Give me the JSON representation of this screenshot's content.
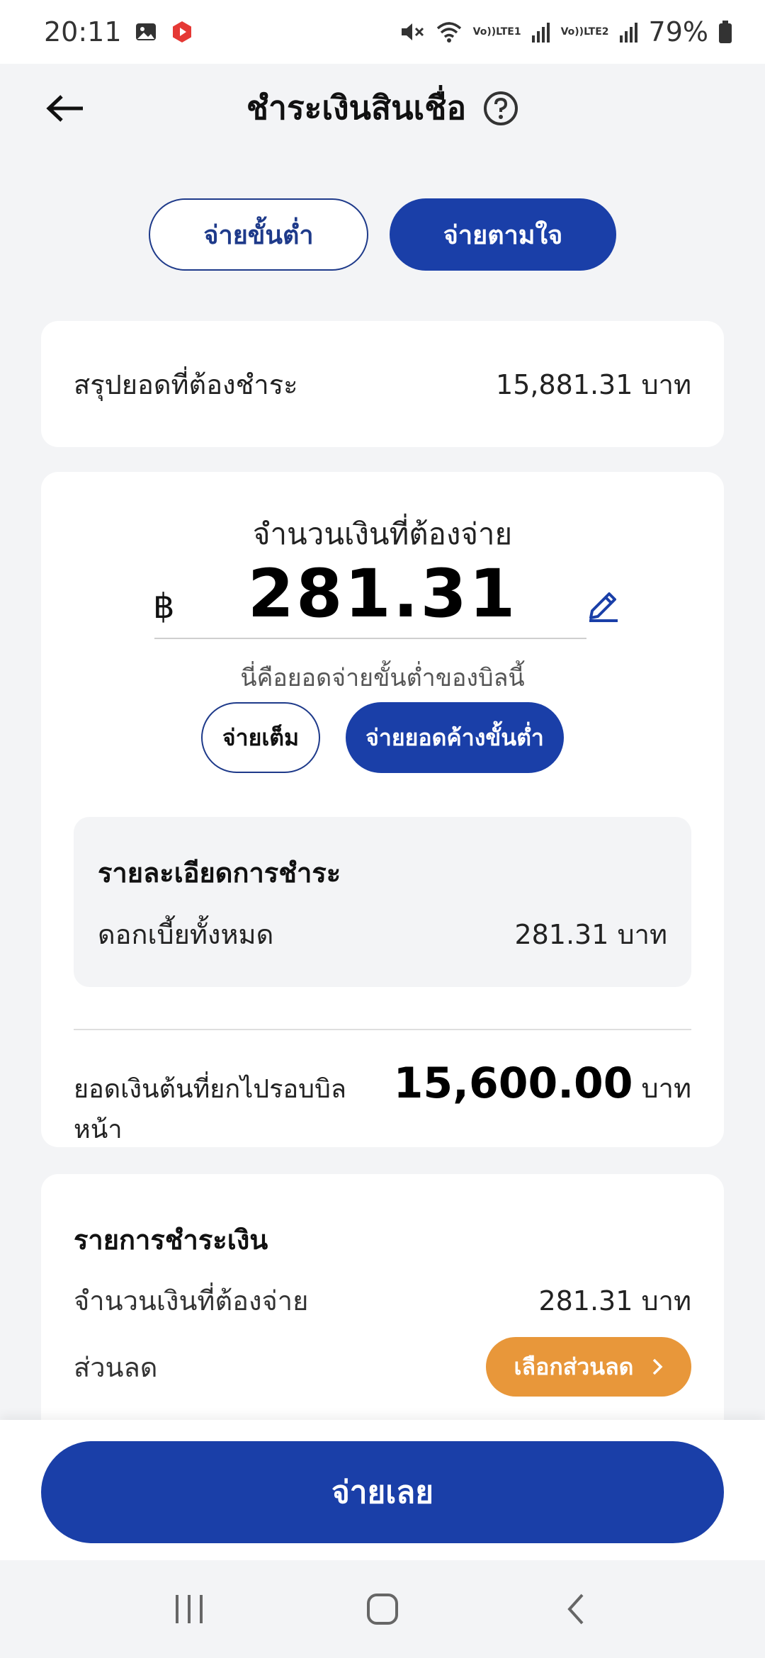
{
  "status_bar": {
    "time": "20:11",
    "sim1_label_top": "Vo))",
    "sim1_label_bottom": "LTE1",
    "sim2_label_top": "Vo))",
    "sim2_label_bottom": "LTE2",
    "battery": "79%",
    "icons": [
      "gallery-icon",
      "youtube-icon",
      "mute-icon",
      "wifi-icon",
      "signal-icon",
      "battery-icon"
    ]
  },
  "header": {
    "title": "ชำระเงินสินเชื่อ",
    "back_icon": "arrow-left-icon",
    "help_icon": "help-circle-icon"
  },
  "mode_toggle": {
    "options": [
      "จ่ายขั้นต่ำ",
      "จ่ายตามใจ"
    ],
    "selected": "จ่ายตามใจ"
  },
  "summary": {
    "label": "สรุปยอดที่ต้องชำระ",
    "value": "15,881.31 บาท"
  },
  "amount": {
    "title": "จำนวนเงินที่ต้องจ่าย",
    "currency_symbol": "฿",
    "value": "281.31",
    "hint": "นี่คือยอดจ่ายขั้นต่ำของบิลนี้",
    "quick_options": [
      "จ่ายเต็ม",
      "จ่ายยอดค้างขั้นต่ำ"
    ],
    "selected_quick_option": "จ่ายยอดค้างขั้นต่ำ"
  },
  "payment_detail": {
    "title": "รายละเอียดการชำระ",
    "row_label": "ดอกเบี้ยทั้งหมด",
    "row_value": "281.31 บาท"
  },
  "carry_over": {
    "label": "ยอดเงินต้นที่ยกไปรอบบิลหน้า",
    "value": "15,600.00",
    "unit": "บาท"
  },
  "payment_list": {
    "title": "รายการชำระเงิน",
    "amount_label": "จำนวนเงินที่ต้องจ่าย",
    "amount_value": "281.31 บาท",
    "discount_label": "ส่วนลด",
    "discount_button": "เลือกส่วนลด"
  },
  "footer": {
    "pay_button": "จ่ายเลย"
  },
  "colors": {
    "primary": "#1a3fa8",
    "accent_orange": "#e8973a",
    "background": "#f3f4f6"
  }
}
